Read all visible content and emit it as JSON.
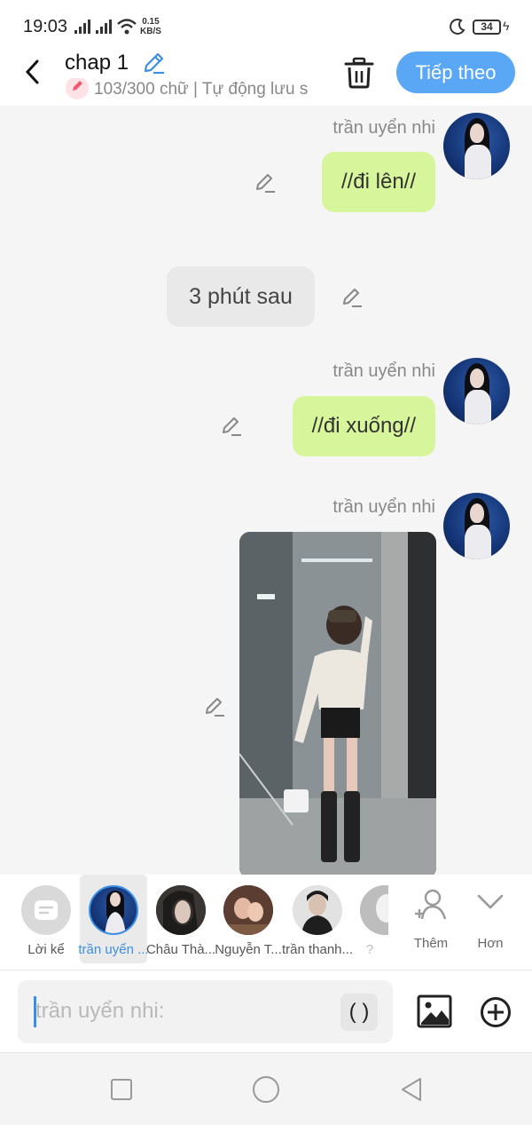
{
  "status_bar": {
    "time": "19:03",
    "speed_value": "0.15",
    "speed_unit": "KB/S",
    "battery": "34"
  },
  "header": {
    "title": "chap 1",
    "subtitle": "103/300 chữ | Tự động lưu s",
    "next_label": "Tiếp theo"
  },
  "messages": [
    {
      "type": "dialogue",
      "sender": "trần uyển nhi",
      "text": "//đi lên//"
    },
    {
      "type": "narration",
      "text": "3 phút sau"
    },
    {
      "type": "dialogue",
      "sender": "trần uyển nhi",
      "text": "//đi xuống//"
    },
    {
      "type": "image",
      "sender": "trần uyển nhi"
    }
  ],
  "characters": [
    {
      "label": "Lời kể"
    },
    {
      "label": "trần uyển ..."
    },
    {
      "label": "Châu Thà..."
    },
    {
      "label": "Nguyễn T..."
    },
    {
      "label": "trần thanh..."
    },
    {
      "label": "?"
    }
  ],
  "tools": {
    "add_label": "Thêm",
    "more_label": "Hơn"
  },
  "input": {
    "placeholder": "trần uyển nhi:",
    "paren_label": "( )"
  },
  "colors": {
    "accent": "#5aa8f5",
    "bubble": "#d7f59a"
  }
}
